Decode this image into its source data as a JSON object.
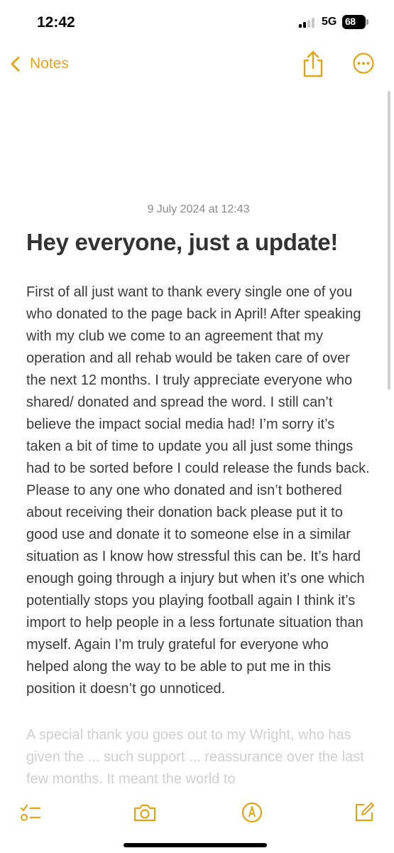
{
  "status": {
    "time": "12:42",
    "network": "5G",
    "battery": "68"
  },
  "nav": {
    "back_label": "Notes"
  },
  "note": {
    "date": "9 July 2024 at 12:43",
    "title": "Hey everyone, just a update!",
    "body": "First of all just want to thank every single one of you who donated to the page back in April! After speaking with my club we come to an agreement that my operation and all rehab would be taken care of over the next 12 months. I truly appreciate everyone who shared/ donated and spread the word. I still can’t believe the impact social media had! I’m sorry it’s taken a bit of time to update you all just some things had to be sorted before I could release the funds back. Please to any one who donated and isn’t bothered about receiving their donation back please put it to good use and donate it to someone else in a similar situation as I know how stressful this can be. It’s hard enough going through a injury but when it’s one which potentially stops you playing football again I think it’s import to help people in a less fortunate situation than myself. Again I’m truly grateful for everyone who helped along the way to be able to put me in this position it doesn’t go unnoticed.",
    "body_2": "A special thank you goes out to my Wright, who has given the ... such support ... reassurance over the last few months. It meant the world to"
  },
  "icons": {
    "back": "chevron-left-icon",
    "share": "share-icon",
    "more": "ellipsis-circle-icon",
    "checklist": "checklist-icon",
    "camera": "camera-icon",
    "markup": "pen-circle-icon",
    "compose": "compose-icon"
  },
  "colors": {
    "accent": "#e0a416",
    "date_text": "#8a8a8e",
    "title_text": "#333333",
    "body_text": "#3a3a3a"
  }
}
